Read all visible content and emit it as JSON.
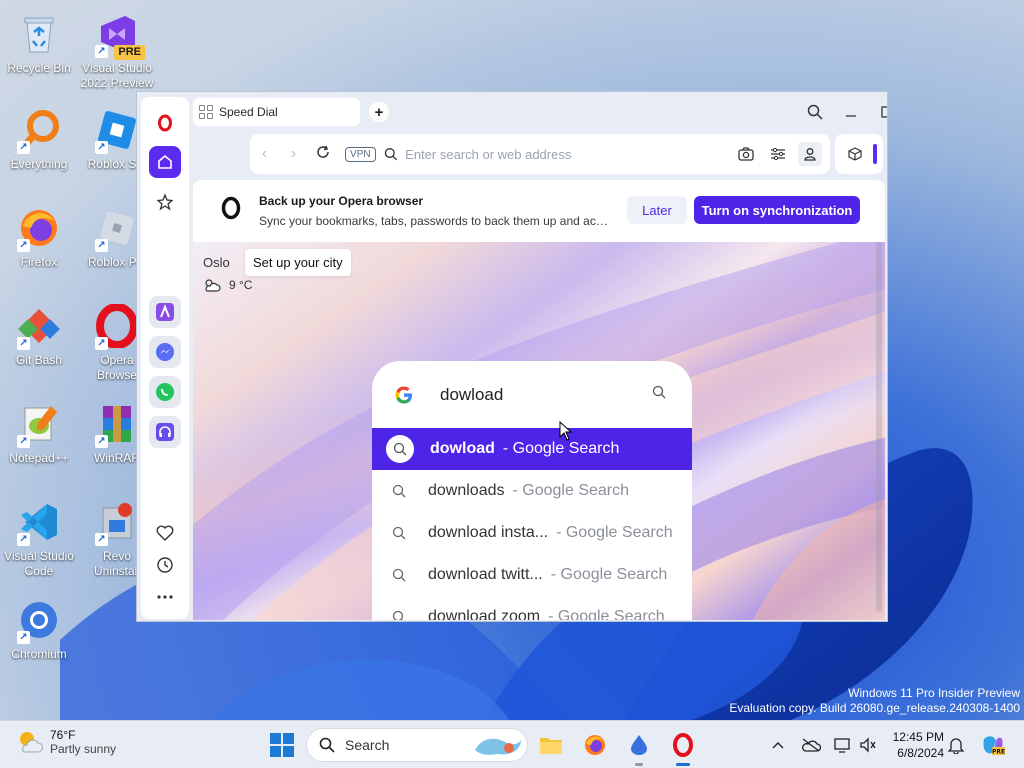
{
  "desktop": {
    "icons": [
      {
        "label": "Recycle Bin"
      },
      {
        "label": "Visual Studio 2022 Preview",
        "badge": "PRE"
      },
      {
        "label": "Everything"
      },
      {
        "label": "Roblox Stu"
      },
      {
        "label": "Firefox"
      },
      {
        "label": "Roblox Pla"
      },
      {
        "label": "Git Bash"
      },
      {
        "label": "Opera Browse"
      },
      {
        "label": "Notepad++"
      },
      {
        "label": "WinRAR"
      },
      {
        "label": "Visual Studio Code"
      },
      {
        "label": "Revo Uninstall"
      },
      {
        "label": "Chromium"
      }
    ]
  },
  "browser": {
    "tab_title": "Speed Dial",
    "new_tab_glyph": "+",
    "address_placeholder": "Enter search or web address",
    "vpn_label": "VPN",
    "sync": {
      "title": "Back up your Opera browser",
      "description": "Sync your bookmarks, tabs, passwords to back them up and acc...",
      "later_label": "Later",
      "turn_on_label": "Turn on synchronization"
    },
    "weather": {
      "city": "Oslo",
      "setup_label": "Set up your city",
      "temperature": "9 °C"
    },
    "search": {
      "query": "dowload",
      "suggestions": [
        {
          "query": "dowload",
          "suffix": "- Google Search",
          "selected": true
        },
        {
          "query": "downloads",
          "suffix": "- Google Search",
          "selected": false
        },
        {
          "query": "download insta...",
          "suffix": "- Google Search",
          "selected": false
        },
        {
          "query": "download twitt...",
          "suffix": "- Google Search",
          "selected": false
        },
        {
          "query": "download zoom",
          "suffix": "- Google Search",
          "selected": false
        }
      ]
    },
    "accent_color": "#4f24e9"
  },
  "watermark": {
    "line1": "Windows 11 Pro Insider Preview",
    "line2": "Evaluation copy. Build 26080.ge_release.240308-1400"
  },
  "taskbar": {
    "weather_temp": "76°F",
    "weather_desc": "Partly sunny",
    "search_label": "Search",
    "time": "12:45 PM",
    "date": "6/8/2024"
  }
}
